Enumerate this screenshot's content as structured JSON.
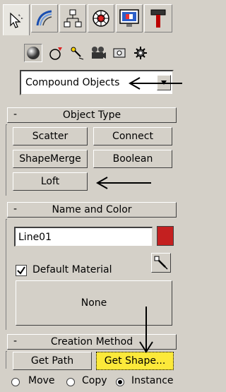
{
  "dropdown": {
    "value": "Compound Objects"
  },
  "object_type": {
    "title": "Object Type",
    "collapse": "-",
    "buttons": [
      "Scatter",
      "Connect",
      "ShapeMerge",
      "Boolean",
      "Loft"
    ]
  },
  "name_color": {
    "title": "Name and Color",
    "collapse": "-",
    "name_value": "Line01",
    "color": "#c42020",
    "default_material": "Default Material",
    "material_button": "None"
  },
  "creation": {
    "title": "Creation Method",
    "collapse": "-",
    "get_path": "Get Path",
    "get_shape": "Get Shape...",
    "radios": [
      "Move",
      "Copy",
      "Instance"
    ]
  }
}
